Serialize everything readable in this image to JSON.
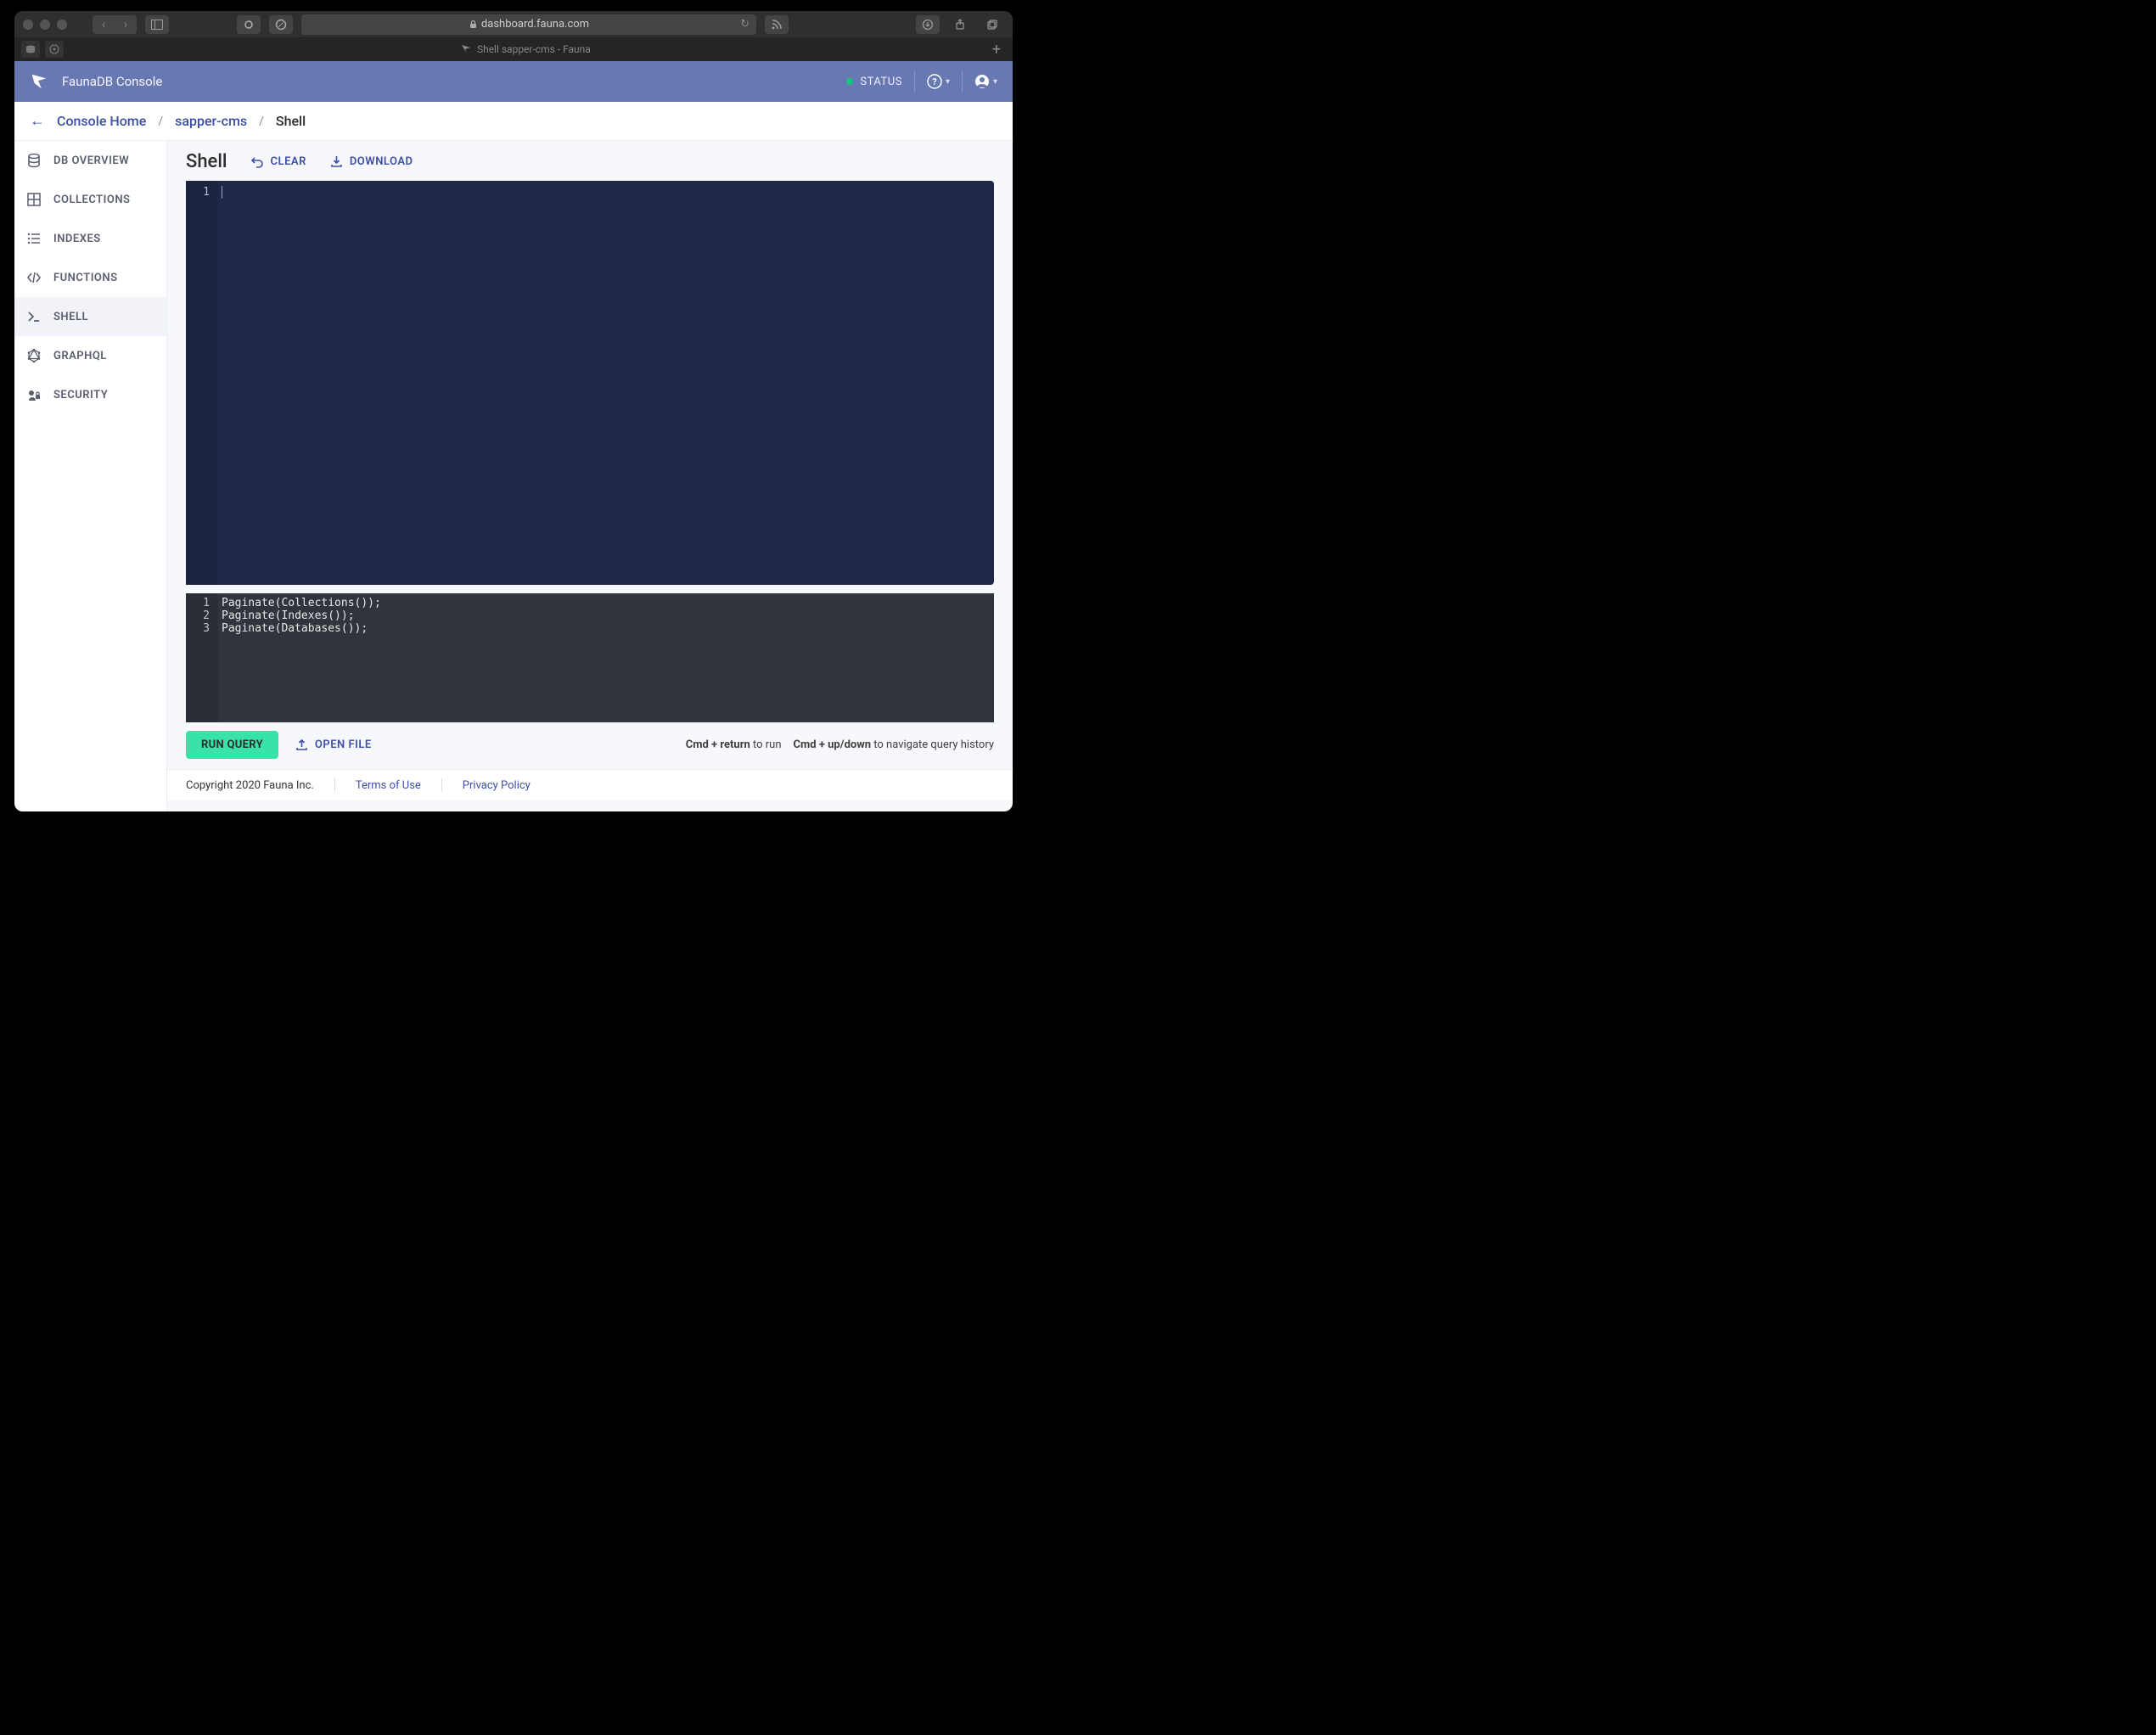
{
  "browser": {
    "url": "dashboard.fauna.com",
    "tab_title": "Shell sapper-cms - Fauna"
  },
  "appbar": {
    "title": "FaunaDB Console",
    "status": "STATUS"
  },
  "breadcrumbs": {
    "items": [
      "Console Home",
      "sapper-cms",
      "Shell"
    ]
  },
  "sidebar": {
    "items": [
      {
        "label": "DB OVERVIEW",
        "icon": "database-icon"
      },
      {
        "label": "COLLECTIONS",
        "icon": "grid-icon"
      },
      {
        "label": "INDEXES",
        "icon": "list-icon"
      },
      {
        "label": "FUNCTIONS",
        "icon": "code-icon"
      },
      {
        "label": "SHELL",
        "icon": "terminal-icon"
      },
      {
        "label": "GRAPHQL",
        "icon": "graphql-icon"
      },
      {
        "label": "SECURITY",
        "icon": "security-icon"
      }
    ],
    "active_index": 4
  },
  "shell": {
    "title": "Shell",
    "clear": "CLEAR",
    "download": "DOWNLOAD",
    "editor": {
      "line_numbers": [
        "1"
      ],
      "content": ""
    },
    "output": {
      "lines": [
        {
          "n": "1",
          "text": "Paginate(Collections());"
        },
        {
          "n": "2",
          "text": "Paginate(Indexes());"
        },
        {
          "n": "3",
          "text": "Paginate(Databases());"
        }
      ]
    },
    "run_label": "RUN QUERY",
    "open_file": "OPEN FILE",
    "hint1_bold": "Cmd + return",
    "hint1_rest": " to run",
    "hint2_bold": "Cmd + up/down",
    "hint2_rest": " to navigate query history"
  },
  "footer": {
    "copyright": "Copyright 2020 Fauna Inc.",
    "terms": "Terms of Use",
    "privacy": "Privacy Policy"
  }
}
